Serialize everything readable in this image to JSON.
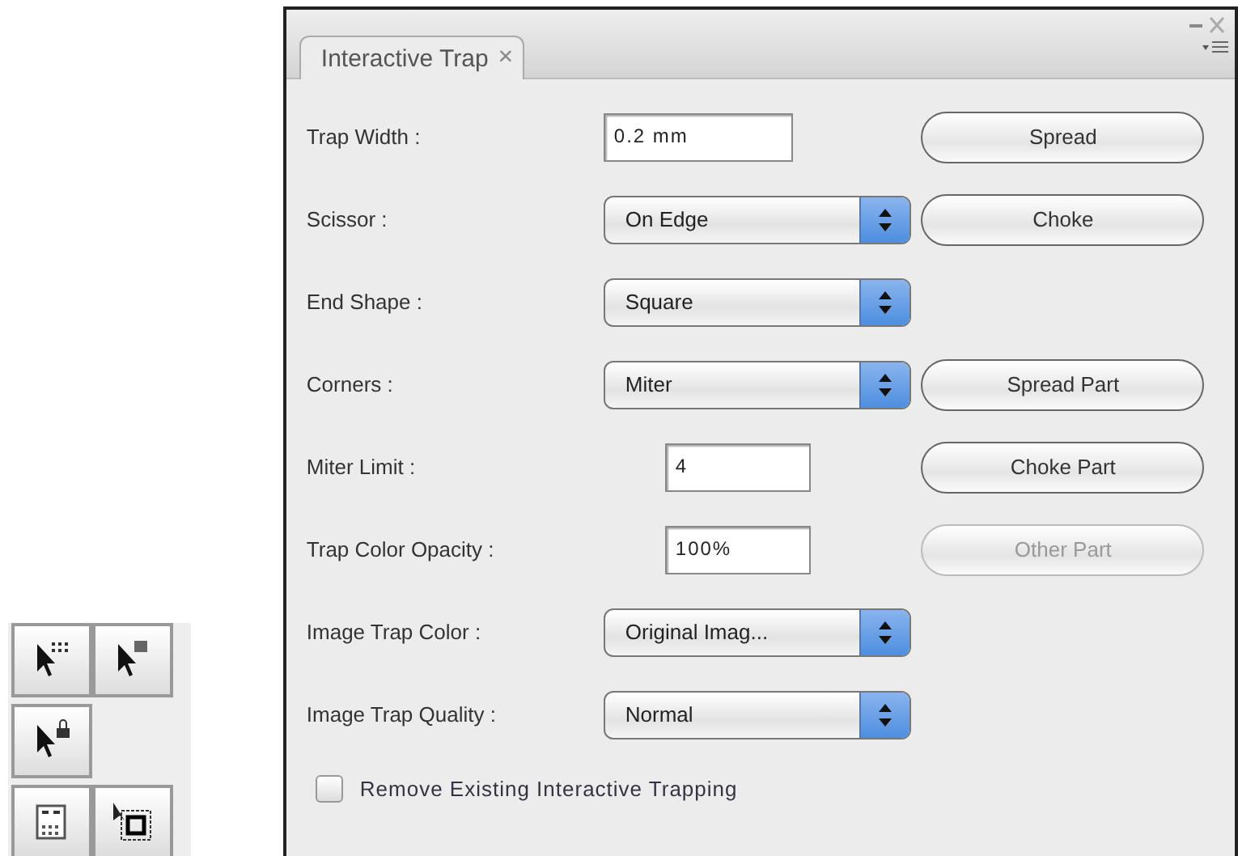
{
  "panel": {
    "tab": {
      "label": "Interactive Trap",
      "close": "×",
      "selected": true
    },
    "rows": [
      {
        "label": "Trap Width :",
        "kind": "field",
        "value": "0.2 mm",
        "button": {
          "label": "Spread",
          "disabled": false
        }
      },
      {
        "label": "Scissor :",
        "kind": "dropdown",
        "value": "On Edge",
        "button": {
          "label": "Choke",
          "disabled": false
        }
      },
      {
        "label": "End Shape :",
        "kind": "dropdown",
        "value": "Square"
      },
      {
        "label": "Corners :",
        "kind": "dropdown",
        "value": "Miter",
        "button": {
          "label": "Spread Part",
          "disabled": false
        }
      },
      {
        "label": "Miter Limit :",
        "kind": "short-field",
        "value": "4",
        "button": {
          "label": "Choke Part",
          "disabled": false
        }
      },
      {
        "label": "Trap Color Opacity :",
        "kind": "short-field",
        "value": "100%",
        "button": {
          "label": "Other Part",
          "disabled": true
        }
      },
      {
        "label": "Image Trap Color :",
        "kind": "dropdown",
        "value": "Original Imag..."
      },
      {
        "label": "Image Trap Quality :",
        "kind": "dropdown",
        "value": "Normal"
      }
    ],
    "checkbox": {
      "label": "Remove Existing Interactive Trapping",
      "checked": false
    }
  }
}
